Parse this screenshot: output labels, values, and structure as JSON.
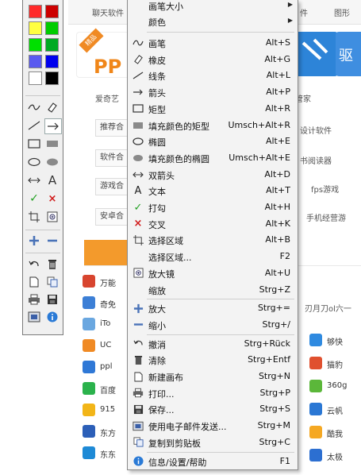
{
  "background": {
    "nav": [
      "聊天软件",
      "件",
      "图形"
    ],
    "hot_tag": "精品",
    "card_brand": "PP",
    "card_caption_1": "爱奇艺",
    "card_caption_2": "管家",
    "card_caption_3": "驱",
    "row1": [
      "推荐合",
      "设计软件"
    ],
    "row2": [
      "软件合",
      "书阅读器"
    ],
    "row3": [
      "游戏合",
      "fps游戏"
    ],
    "row4": [
      "安卓合",
      "手机经营游"
    ],
    "side_text_1": "刃月刀ol六一",
    "list_left": [
      {
        "label": "万能",
        "color": "#d8452f"
      },
      {
        "label": "奇免",
        "color": "#3c7fd6"
      },
      {
        "label": "iTo",
        "color": "#6aa7e0"
      },
      {
        "label": "UC",
        "color": "#f08a24"
      },
      {
        "label": "ppl",
        "color": "#2f78d6"
      },
      {
        "label": "百度",
        "color": "#2bb24c"
      },
      {
        "label": "915",
        "color": "#f2b518"
      },
      {
        "label": "东方",
        "color": "#2c5fb8"
      },
      {
        "label": "东东",
        "color": "#1e8ad6"
      }
    ],
    "list_right": [
      {
        "label": "够快",
        "color": "#2f8ae0"
      },
      {
        "label": "猫豹",
        "color": "#e0502f"
      },
      {
        "label": "360g",
        "color": "#5bb73a"
      },
      {
        "label": "云帆",
        "color": "#2a77d4"
      },
      {
        "label": "酷我",
        "color": "#f5a823"
      },
      {
        "label": "太极",
        "color": "#2c6fd1"
      }
    ]
  },
  "palette": {
    "colors": [
      [
        "#ff2a2a",
        "#cc0000"
      ],
      [
        "#ffff40",
        "#00cc00"
      ],
      [
        "#00e000",
        "#00aa22"
      ],
      [
        "#5a5af0",
        "#0000ee"
      ],
      [
        "#ffffff",
        "#000000"
      ]
    ]
  },
  "menu": {
    "header_items": [
      {
        "label": "画笔大小",
        "has_submenu": true
      },
      {
        "label": "颜色",
        "has_submenu": true
      }
    ],
    "items": [
      {
        "icon": "pen-icon",
        "label": "画笔",
        "shortcut": "Alt+S"
      },
      {
        "icon": "eraser-icon",
        "label": "橡皮",
        "shortcut": "Alt+G"
      },
      {
        "icon": "line-icon",
        "label": "线条",
        "shortcut": "Alt+L"
      },
      {
        "icon": "arrow-icon",
        "label": "箭头",
        "shortcut": "Alt+P"
      },
      {
        "icon": "rectangle-icon",
        "label": "矩型",
        "shortcut": "Alt+R"
      },
      {
        "icon": "filled-rectangle-icon",
        "label": "填充颜色的矩型",
        "shortcut": "Umsch+Alt+R"
      },
      {
        "icon": "ellipse-icon",
        "label": "椭圆",
        "shortcut": "Alt+E"
      },
      {
        "icon": "filled-ellipse-icon",
        "label": "填充颜色的椭圆",
        "shortcut": "Umsch+Alt+E"
      },
      {
        "icon": "double-arrow-icon",
        "label": "双箭头",
        "shortcut": "Alt+D"
      },
      {
        "icon": "text-icon",
        "label": "文本",
        "shortcut": "Alt+T"
      },
      {
        "icon": "checkmark-icon",
        "label": "打勾",
        "shortcut": "Alt+H"
      },
      {
        "icon": "cross-icon",
        "label": "交叉",
        "shortcut": "Alt+K"
      },
      {
        "icon": "select-area-icon",
        "label": "选择区域",
        "shortcut": "Alt+B"
      },
      {
        "icon": "",
        "label": "选择区域...",
        "shortcut": "F2"
      },
      {
        "icon": "magnifier-icon",
        "label": "放大镜",
        "shortcut": "Alt+U"
      },
      {
        "icon": "",
        "label": "缩放",
        "shortcut": "Strg+Z"
      },
      {
        "icon": "zoom-in-icon",
        "label": "放大",
        "shortcut": "Strg+="
      },
      {
        "icon": "zoom-out-icon",
        "label": "缩小",
        "shortcut": "Strg+/"
      },
      {
        "icon": "undo-icon",
        "label": "撤消",
        "shortcut": "Strg+Rück"
      },
      {
        "icon": "trash-icon",
        "label": "清除",
        "shortcut": "Strg+Entf"
      },
      {
        "icon": "new-canvas-icon",
        "label": "新建画布",
        "shortcut": "Strg+N"
      },
      {
        "icon": "print-icon",
        "label": "打印...",
        "shortcut": "Strg+P"
      },
      {
        "icon": "save-icon",
        "label": "保存...",
        "shortcut": "Strg+S"
      },
      {
        "icon": "email-icon",
        "label": "使用电子邮件发送...",
        "shortcut": "Strg+M"
      },
      {
        "icon": "copy-clipboard-icon",
        "label": "复制到剪贴板",
        "shortcut": "Strg+C"
      },
      {
        "icon": "info-icon",
        "label": "信息/设置/帮助",
        "shortcut": "F1"
      }
    ]
  }
}
